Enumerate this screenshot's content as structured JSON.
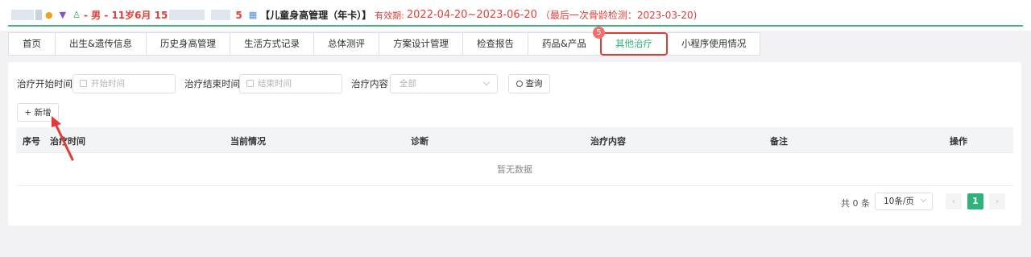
{
  "header": {
    "gender_age": "- 男 - 11岁6月 15",
    "phone_suffix": "5",
    "package": "【儿童身高管理（年卡）】",
    "validity_label": "有效期:",
    "validity_range": "2022-04-20~2023-06-20",
    "last_check": "（最后一次骨龄检测：2023-03-20)"
  },
  "tabs": [
    {
      "label": "首页"
    },
    {
      "label": "出生&遗传信息"
    },
    {
      "label": "历史身高管理"
    },
    {
      "label": "生活方式记录"
    },
    {
      "label": "总体测评"
    },
    {
      "label": "方案设计管理"
    },
    {
      "label": "检查报告"
    },
    {
      "label": "药品&产品",
      "badge": "5"
    },
    {
      "label": "其他治疗",
      "active": true
    },
    {
      "label": "小程序使用情况"
    }
  ],
  "filters": {
    "start_label": "治疗开始时间",
    "start_placeholder": "开始时间",
    "end_label": "治疗结束时间",
    "end_placeholder": "结束时间",
    "content_label": "治疗内容",
    "content_value": "全部",
    "query_button": "查询"
  },
  "add_button": "+ 新增",
  "table": {
    "columns": [
      "序号",
      "治疗时间",
      "当前情况",
      "诊断",
      "治疗内容",
      "备注",
      "操作"
    ],
    "empty_text": "暂无数据"
  },
  "pagination": {
    "total": "共 0 条",
    "page_size": "10条/页",
    "current_page": "1",
    "prev_icon": "‹",
    "next_icon": "›"
  },
  "colors": {
    "accent": "#2fb37a",
    "highlight": "#e53935",
    "badge": "#f56c6c"
  }
}
